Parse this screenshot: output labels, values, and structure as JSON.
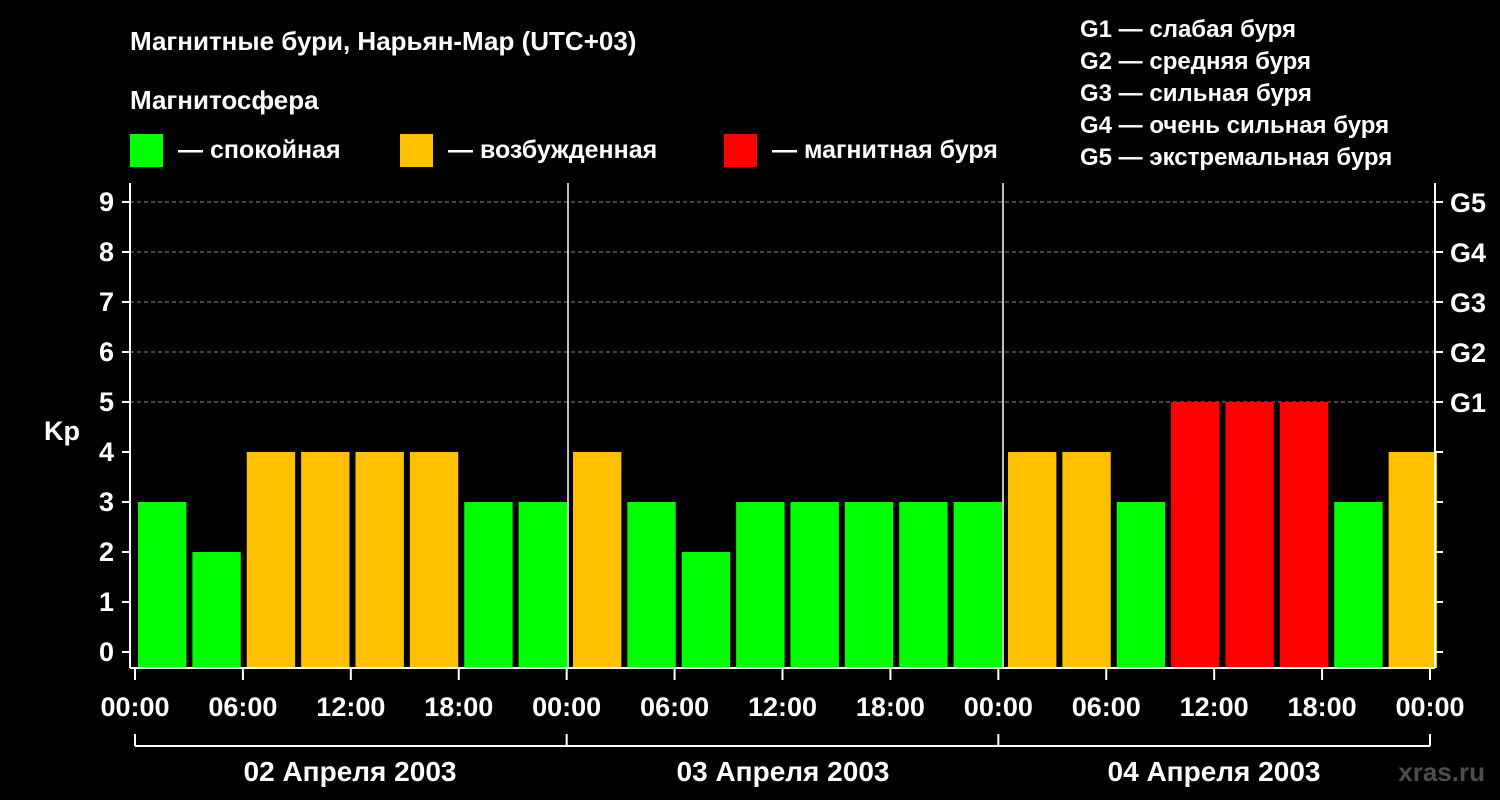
{
  "chart_data": {
    "type": "bar",
    "title": "Магнитные бури, Нарьян-Мар (UTC+03)",
    "subtitle": "Магнитосфера",
    "ylabel": "Kp",
    "ylim": [
      0,
      9
    ],
    "yticks": [
      "0",
      "1",
      "2",
      "3",
      "4",
      "5",
      "6",
      "7",
      "8",
      "9"
    ],
    "y2ticks": [
      {
        "level": 5,
        "label": "G1"
      },
      {
        "level": 6,
        "label": "G2"
      },
      {
        "level": 7,
        "label": "G3"
      },
      {
        "level": 8,
        "label": "G4"
      },
      {
        "level": 9,
        "label": "G5"
      }
    ],
    "xticks": [
      "00:00",
      "06:00",
      "12:00",
      "18:00",
      "00:00",
      "06:00",
      "12:00",
      "18:00",
      "00:00",
      "06:00",
      "12:00",
      "18:00",
      "00:00"
    ],
    "days": [
      "02 Апреля 2003",
      "03 Апреля 2003",
      "04 Апреля 2003"
    ],
    "legend": [
      {
        "label": "— спокойная",
        "color": "#00ff00"
      },
      {
        "label": "— возбужденная",
        "color": "#ffc000"
      },
      {
        "label": "— магнитная буря",
        "color": "#ff0000"
      }
    ],
    "scale_legend": [
      "G1 — слабая буря",
      "G2 — средняя буря",
      "G3 — сильная буря",
      "G4 — очень сильная буря",
      "G5 — экстремальная буря"
    ],
    "grid": true,
    "values": [
      3,
      2,
      4,
      4,
      4,
      4,
      3,
      3,
      4,
      3,
      2,
      3,
      3,
      3,
      3,
      3,
      4,
      4,
      3,
      5,
      5,
      5,
      3,
      4
    ],
    "bar_colors": [
      "#00ff00",
      "#00ff00",
      "#ffc000",
      "#ffc000",
      "#ffc000",
      "#ffc000",
      "#00ff00",
      "#00ff00",
      "#ffc000",
      "#00ff00",
      "#00ff00",
      "#00ff00",
      "#00ff00",
      "#00ff00",
      "#00ff00",
      "#00ff00",
      "#ffc000",
      "#ffc000",
      "#00ff00",
      "#ff0000",
      "#ff0000",
      "#ff0000",
      "#00ff00",
      "#ffc000"
    ]
  },
  "watermark": "xras.ru"
}
